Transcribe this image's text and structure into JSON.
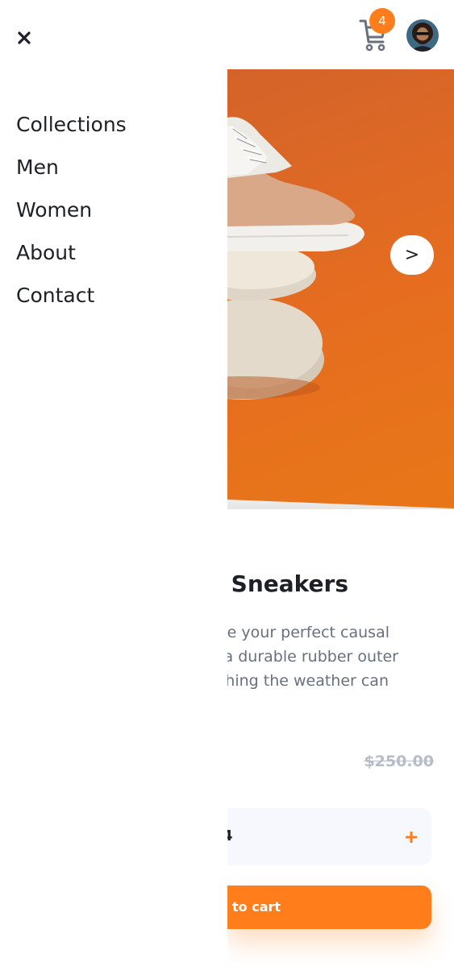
{
  "header": {
    "cart_count": "4",
    "close_icon": "close-icon",
    "cart_icon": "cart-icon"
  },
  "gallery": {
    "next_label": ">"
  },
  "product": {
    "title_visible": "n Sneakers",
    "description_lines": [
      "re your perfect causal",
      "a durable rubber outer",
      "thing the weather can"
    ],
    "original_price": "$250.00",
    "quantity_partial": "4",
    "add_to_cart_label": "to cart"
  },
  "menu": {
    "items": [
      "Collections",
      "Men",
      "Women",
      "About",
      "Contact"
    ]
  },
  "colors": {
    "accent": "#ff7e1b",
    "text_dark": "#1d2026",
    "text_muted": "#68707d"
  }
}
